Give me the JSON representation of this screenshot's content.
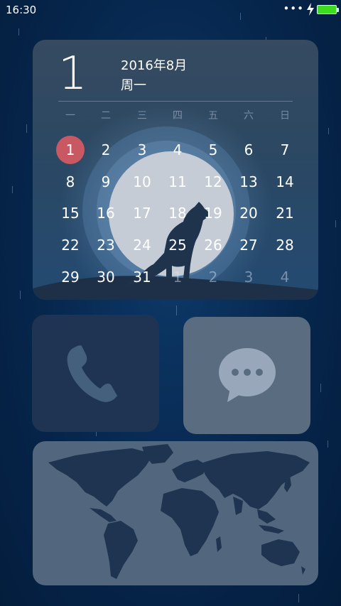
{
  "status_bar": {
    "time": "16:30",
    "signal_icon": "more-dots-icon",
    "charging_icon": "bolt-icon",
    "battery_icon": "battery-icon",
    "battery_color": "#3ddc20"
  },
  "calendar": {
    "big_day": "1",
    "year_month": "2016年8月",
    "weekday": "周一",
    "week_headers": [
      "一",
      "二",
      "三",
      "四",
      "五",
      "六",
      "日"
    ],
    "days": [
      [
        "1",
        "2",
        "3",
        "4",
        "5",
        "6",
        "7"
      ],
      [
        "8",
        "9",
        "10",
        "11",
        "12",
        "13",
        "14"
      ],
      [
        "15",
        "16",
        "17",
        "18",
        "19",
        "20",
        "21"
      ],
      [
        "22",
        "23",
        "24",
        "25",
        "26",
        "27",
        "28"
      ],
      [
        "29",
        "30",
        "31",
        "1",
        "2",
        "3",
        "4"
      ]
    ],
    "today_color": "#c85963"
  },
  "apps": [
    {
      "name": "Phone",
      "icon": "phone-icon"
    },
    {
      "name": "Messages",
      "icon": "message-bubble-icon"
    },
    {
      "name": "World Map",
      "icon": "world-map-icon"
    }
  ]
}
